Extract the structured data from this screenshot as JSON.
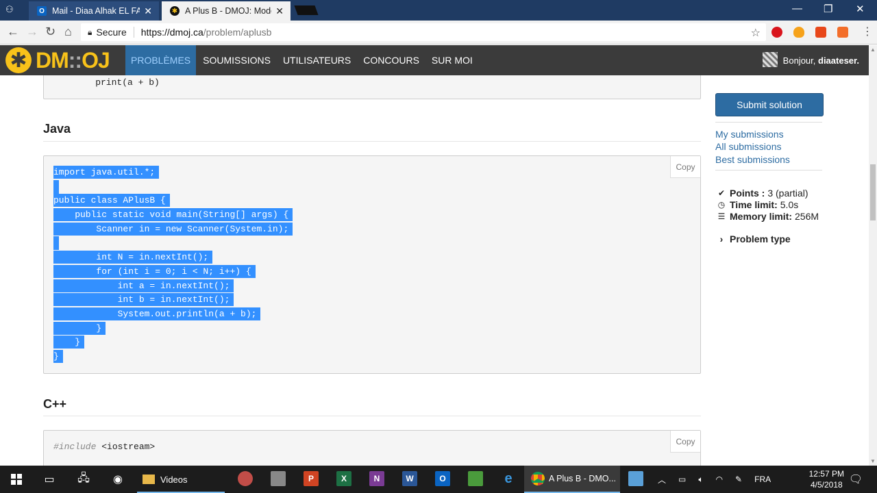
{
  "browser": {
    "tabs": [
      {
        "title": "Mail - Diaa Alhak EL FALI",
        "favicon": "outlook-mail-icon"
      },
      {
        "title": "A Plus B - DMOJ: Moder",
        "favicon": "dmoj-star-icon"
      }
    ],
    "address": {
      "secure_label": "Secure",
      "domain": "https://dmoj.ca",
      "path": "/problem/aplusb"
    }
  },
  "site": {
    "logo": {
      "left": "DM",
      "sep": "::",
      "right": "OJ"
    },
    "nav": [
      "PROBLÈMES",
      "SOUMISSIONS",
      "UTILISATEURS",
      "CONCOURS",
      "SUR MOI"
    ],
    "user": {
      "greeting": "Bonjour,",
      "name": "diaateser."
    }
  },
  "content": {
    "python_last_line": "    print(a + b)",
    "java_heading": "Java",
    "java_code": [
      "import java.util.*;",
      "",
      "public class APlusB {",
      "    public static void main(String[] args) {",
      "        Scanner in = new Scanner(System.in);",
      "",
      "        int N = in.nextInt();",
      "        for (int i = 0; i < N; i++) {",
      "            int a = in.nextInt();",
      "            int b = in.nextInt();",
      "            System.out.println(a + b);",
      "        }",
      "    }",
      "}"
    ],
    "cpp_heading": "C++",
    "cpp_line": {
      "directive": "#include",
      "arg": " <iostream>"
    },
    "copy_label": "Copy"
  },
  "sidebar": {
    "submit_label": "Submit solution",
    "links": [
      "My submissions",
      "All submissions",
      "Best submissions"
    ],
    "points_label": "Points :",
    "points_value": "3 (partial)",
    "time_label": "Time limit:",
    "time_value": "5.0s",
    "memory_label": "Memory limit:",
    "memory_value": "256M",
    "problem_type_label": "Problem type"
  },
  "taskbar": {
    "videos_label": "Videos",
    "active_label": "A Plus B - DMO...",
    "lang": "FRA",
    "time": "12:57 PM",
    "date": "4/5/2018"
  }
}
